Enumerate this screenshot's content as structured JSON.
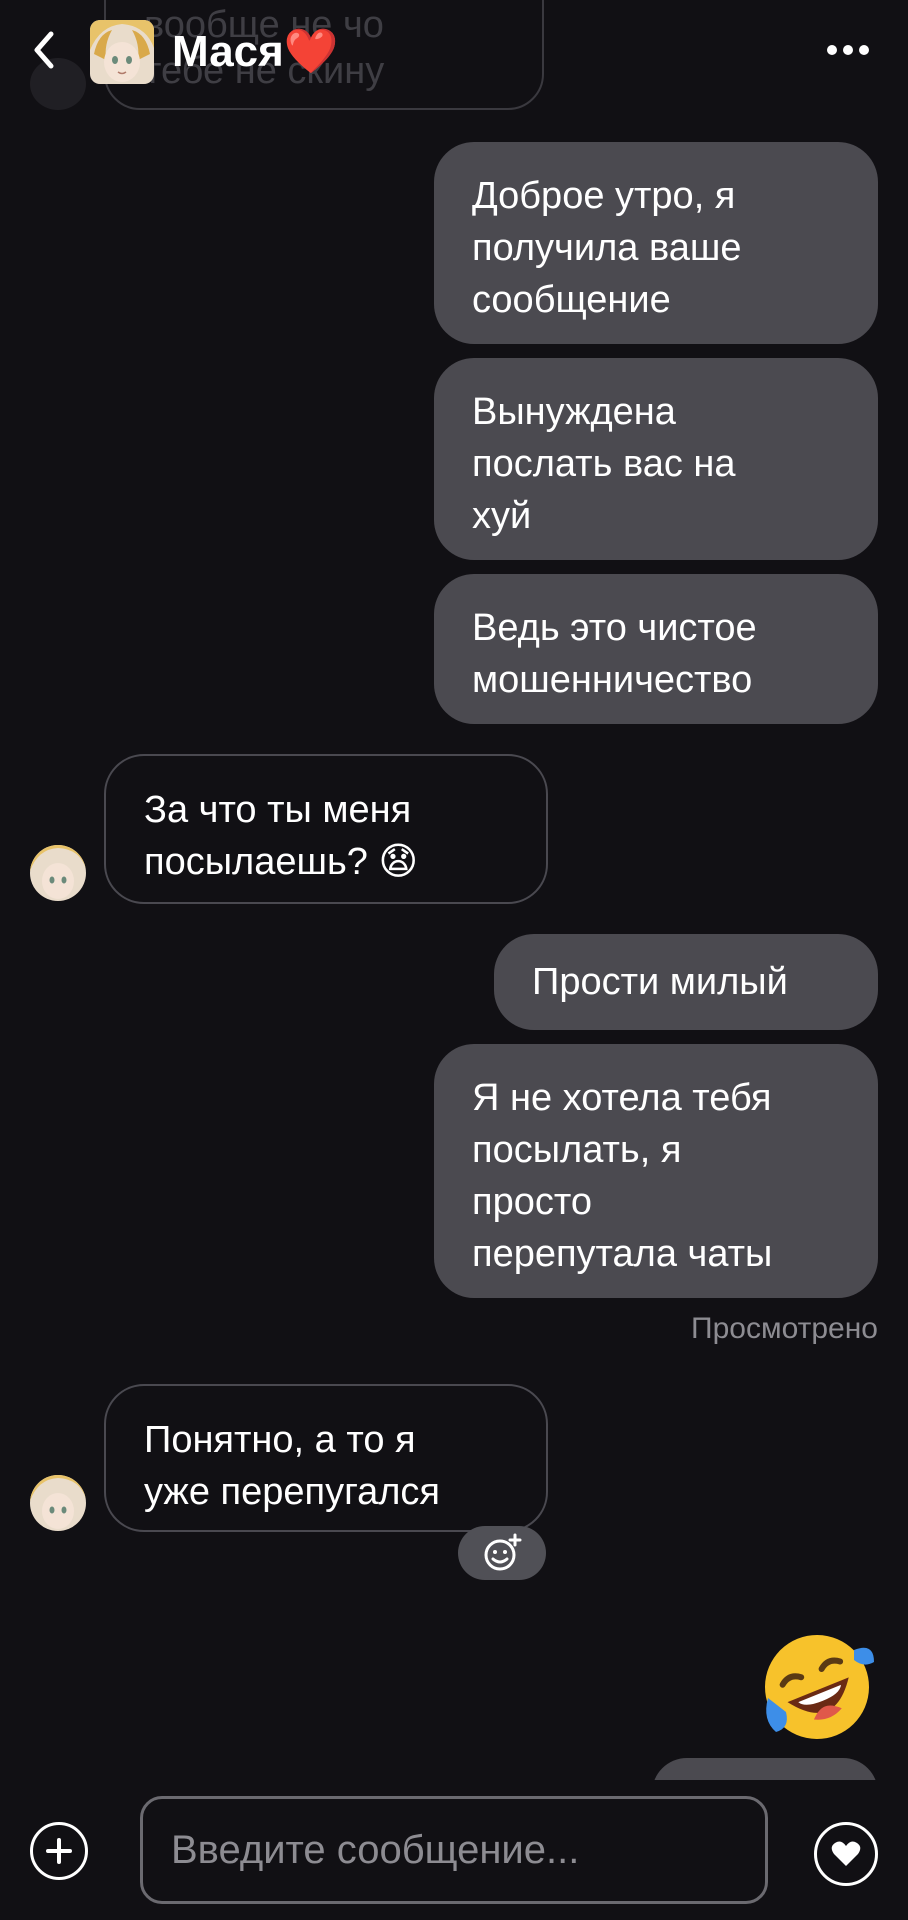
{
  "header": {
    "title": "Мася",
    "title_emoji": "❤️",
    "back_icon": "chevron-left-icon",
    "more_icon": "more-horizontal-icon"
  },
  "top_partial_bubble": {
    "lines": [
      "вообще не чо",
      "тебе не скину"
    ]
  },
  "messages": [
    {
      "direction": "outgoing",
      "lines": [
        "Доброе утро, я",
        "получила ваше",
        "сообщение"
      ]
    },
    {
      "direction": "outgoing",
      "lines": [
        "Вынуждена",
        "послать вас на",
        "хуй"
      ]
    },
    {
      "direction": "outgoing",
      "lines": [
        "Ведь это чистое",
        "мошенничество"
      ]
    },
    {
      "direction": "incoming",
      "lines": [
        "За что ты меня",
        "посылаешь? 😧"
      ]
    },
    {
      "direction": "outgoing",
      "lines": [
        "Прости милый"
      ]
    },
    {
      "direction": "outgoing",
      "lines": [
        "Я не хотела тебя",
        "посылать, я",
        "просто",
        "перепутала чаты"
      ]
    },
    {
      "direction": "incoming",
      "lines": [
        "Понятно, а то я",
        "уже перепугался"
      ]
    }
  ],
  "status": {
    "seen": "Просмотрено"
  },
  "reaction": {
    "emoji": "🤣",
    "add_reaction_icon": "add-reaction-icon"
  },
  "composer": {
    "placeholder": "Введите сообщение...",
    "plus_icon": "plus-icon",
    "heart_icon": "heart-icon"
  },
  "colors": {
    "background": "#111014",
    "outgoing_bubble": "#4b4a50",
    "incoming_border": "#4a4950",
    "muted_text": "#8d8c92"
  }
}
